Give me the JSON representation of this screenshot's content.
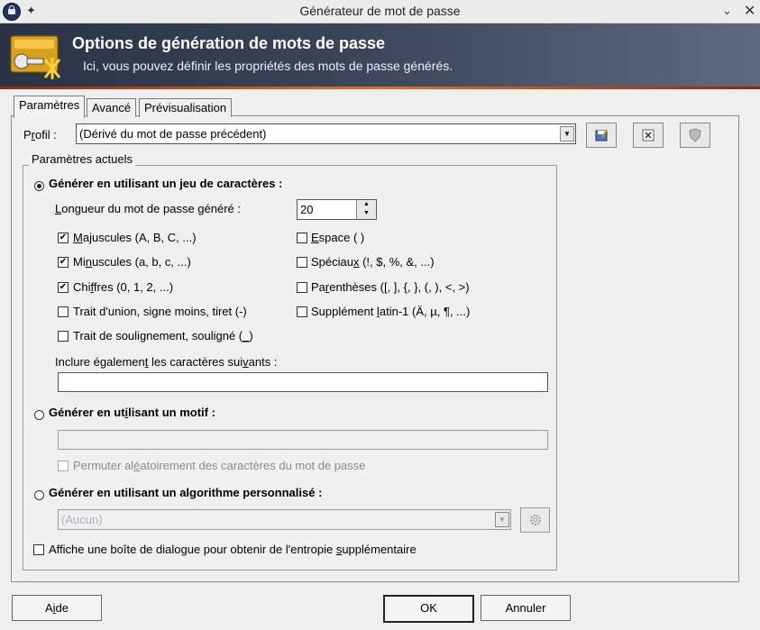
{
  "window": {
    "title": "Générateur de mot de passe",
    "pin_glyph": "✦",
    "chevron_glyph": "⌄",
    "close_glyph": "✕"
  },
  "banner": {
    "heading": "Options de génération de mots de passe",
    "subheading": "Ici, vous pouvez définir les propriétés des mots de passe générés."
  },
  "tabs": [
    {
      "label": "Paramètres",
      "active": true
    },
    {
      "label": "Avancé",
      "active": false
    },
    {
      "label": "Prévisualisation",
      "active": false
    }
  ],
  "profile": {
    "label_pre": "P",
    "label_u": "r",
    "label_post": "ofil :",
    "value": "(Dérivé du mot de passe précédent)",
    "icons": [
      "save-profile-icon",
      "delete-profile-icon",
      "shield-icon"
    ]
  },
  "group": {
    "legend": "Paramètres actuels",
    "charset_radio": "Générer en utilisant un jeu de caractères :",
    "length_label_pre": "",
    "length_label_u": "L",
    "length_label_post": "ongueur du mot de passe généré :",
    "length_value": "20",
    "options_left": [
      {
        "pre": "",
        "u": "M",
        "post": "ajuscules (A, B, C, ...)",
        "checked": true
      },
      {
        "pre": "Mi",
        "u": "n",
        "post": "uscules (a, b, c, ...)",
        "checked": true
      },
      {
        "pre": "Chi",
        "u": "f",
        "post": "fres (0, 1, 2, ...)",
        "checked": true
      },
      {
        "pre": "Trait d'union, signe moins, tiret (-)",
        "u": "",
        "post": "",
        "checked": false
      },
      {
        "pre": "Trait de soulignement, souligné (",
        "u": "_",
        "post": ")",
        "checked": false
      }
    ],
    "options_right": [
      {
        "pre": "",
        "u": "E",
        "post": "space ( )",
        "checked": false
      },
      {
        "pre": "Spéciau",
        "u": "x",
        "post": " (!, $, %, &, ...)",
        "checked": false
      },
      {
        "pre": "Pa",
        "u": "r",
        "post": "enthèses ([, ], {, }, (, ), <, >)",
        "checked": false
      },
      {
        "pre": "Supplément ",
        "u": "l",
        "post": "atin-1  (Ä, µ, ¶, ...)",
        "checked": false
      }
    ],
    "include_label_pre": "Inclure égalemen",
    "include_label_u": "t",
    "include_label_mid": " les caractères sui",
    "include_label_u2": "v",
    "include_label_post": "ants :",
    "include_value": "",
    "pattern_radio_pre": "Générer en ut",
    "pattern_radio_u": "i",
    "pattern_radio_post": "lisant un motif :",
    "pattern_value": "",
    "permute_pre": "Permuter al",
    "permute_u": "é",
    "permute_post": "atoirement des caractères du mot de passe",
    "algo_radio": "Générer en utilisant un algorithme personnalisé :",
    "algo_value": "(Aucun)",
    "entropy_pre": "Affiche une boîte de dialogue pour obtenir de l'entropie ",
    "entropy_u": "s",
    "entropy_post": "upplémentaire"
  },
  "buttons": {
    "help_pre": "A",
    "help_u": "i",
    "help_post": "de",
    "ok": "OK",
    "cancel": "Annuler"
  }
}
